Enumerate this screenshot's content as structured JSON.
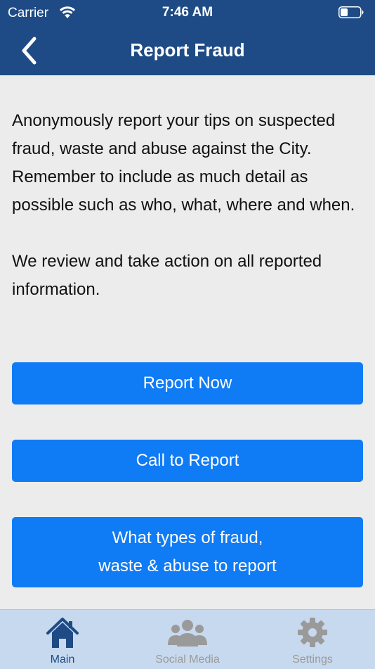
{
  "status_bar": {
    "carrier": "Carrier",
    "time": "7:46 AM"
  },
  "nav": {
    "title": "Report Fraud",
    "back_icon": "chevron-left-icon"
  },
  "content": {
    "paragraph_1": "Anonymously report your tips on suspected fraud, waste and abuse against the City. Remember to include as much detail as possible such as who, what, where and when.",
    "paragraph_2": "We review and take action on all reported information."
  },
  "buttons": {
    "report_now": "Report Now",
    "call_to_report": "Call to Report",
    "types_line_1": "What types of fraud,",
    "types_line_2": "waste & abuse to report"
  },
  "tab_bar": {
    "active_tab": "Main",
    "items": [
      {
        "label": "Main",
        "icon": "home-icon"
      },
      {
        "label": "Social Media",
        "icon": "people-icon"
      },
      {
        "label": "Settings",
        "icon": "gear-icon"
      }
    ]
  },
  "colors": {
    "header": "#1e4b85",
    "button": "#0f7bf5",
    "background": "#ececec",
    "tab_bar": "#c7d9ee",
    "tab_active": "#1e4b85",
    "tab_inactive": "#9a9a9a"
  }
}
